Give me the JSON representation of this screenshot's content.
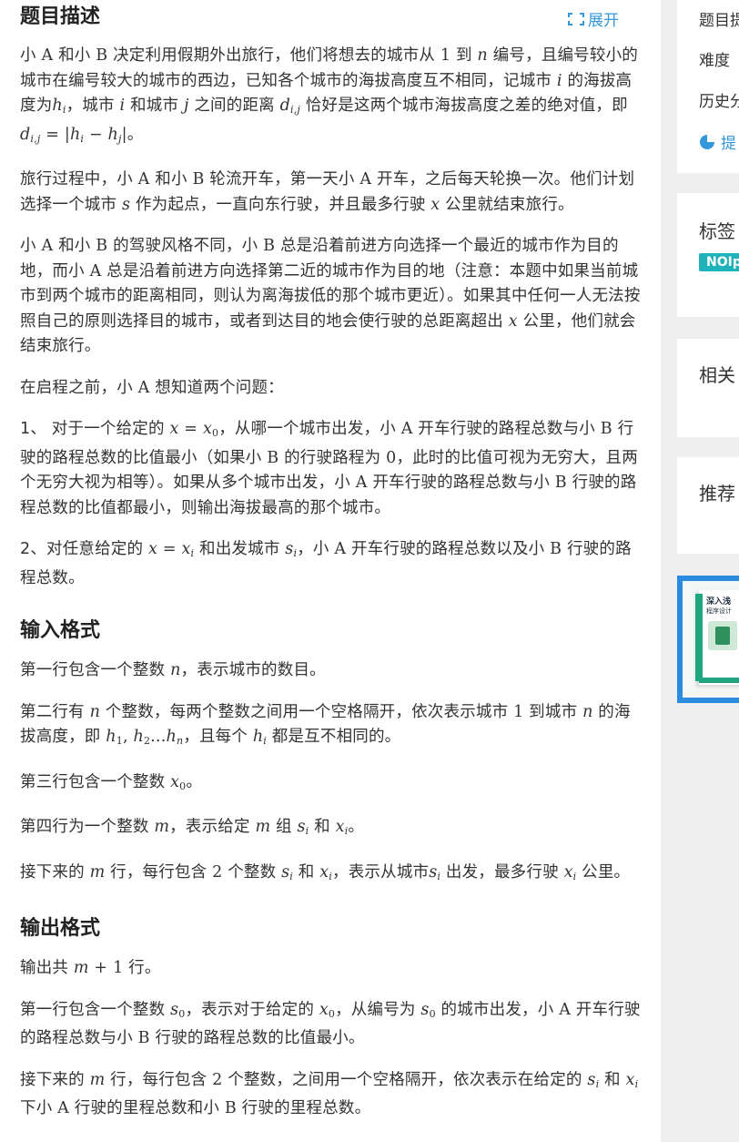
{
  "problem": {
    "title": "题目描述",
    "expand_label": "展开",
    "desc": {
      "p1": [
        "小 ",
        "A",
        " 和小 ",
        "B",
        " 决定利用假期外出旅行，他们将想去的城市从 ",
        "1",
        " 到 ",
        "n",
        " 编号，且编号较小的城市在编号较大的城市的西边，已知各个城市的海拔高度互不相同，记城市 ",
        "i",
        " 的海拔高度为",
        "h",
        "i",
        "，城市 ",
        "i",
        " 和城市 ",
        "j",
        " 之间的距离 ",
        "d",
        "i,j",
        " 恰好是这两个城市海拔高度之差的绝对值，即 ",
        "d",
        "i,j",
        " = |",
        "h",
        "i",
        " − ",
        "h",
        "j",
        "|",
        "。"
      ],
      "p2": [
        "旅行过程中，小 ",
        "A",
        " 和小 ",
        "B",
        " 轮流开车，第一天小 ",
        "A",
        " 开车，之后每天轮换一次。他们计划选择一个城市 ",
        "s",
        " 作为起点，一直向东行驶，并且最多行驶 ",
        "x",
        " 公里就结束旅行。"
      ],
      "p3": [
        "小 ",
        "A",
        " 和小 ",
        "B",
        " 的驾驶风格不同，小 ",
        "B",
        " 总是沿着前进方向选择一个最近的城市作为目的地，而小 ",
        "A",
        " 总是沿着前进方向选择第二近的城市作为目的地（注意：本题中如果当前城市到两个城市的距离相同，则认为离海拔低的那个城市更近）。如果其中任何一人无法按照自己的原则选择目的城市，或者到达目的地会使行驶的总距离超出 ",
        "x",
        " 公里，他们就会结束旅行。"
      ],
      "p4": [
        "在启程之前，小 ",
        "A",
        " 想知道两个问题："
      ],
      "p5": [
        "1、 对于一个给定的 ",
        "x",
        " = ",
        "x",
        "0",
        "，从哪一个城市出发，小 ",
        "A",
        " 开车行驶的路程总数与小 ",
        "B",
        " 行驶的路程总数的比值最小（如果小 ",
        "B",
        " 的行驶路程为 ",
        "0",
        "，此时的比值可视为无穷大，且两个无穷大视为相等）。如果从多个城市出发，小 ",
        "A",
        " 开车行驶的路程总数与小 ",
        "B",
        " 行驶的路程总数的比值都最小，则输出海拔最高的那个城市。"
      ],
      "p6": [
        "2、对任意给定的 ",
        "x",
        " = ",
        "x",
        "i",
        " 和出发城市 ",
        "s",
        "i",
        "，小 ",
        "A",
        " 开车行驶的路程总数以及小 ",
        "B",
        " 行驶的路程总数。"
      ]
    },
    "input_title": "输入格式",
    "input": {
      "i1": [
        "第一行包含一个整数 ",
        "n",
        "，表示城市的数目。"
      ],
      "i2": [
        "第二行有 ",
        "n",
        " 个整数，每两个整数之间用一个空格隔开，依次表示城市 ",
        "1",
        " 到城市 ",
        "n",
        " 的海拔高度，即 ",
        "h",
        "1",
        ", ",
        "h",
        "2",
        "...",
        "h",
        "n",
        "，且每个 ",
        "h",
        "i",
        " 都是互不相同的。"
      ],
      "i3": [
        "第三行包含一个整数 ",
        "x",
        "0",
        "。"
      ],
      "i4": [
        "第四行为一个整数 ",
        "m",
        "，表示给定 ",
        "m",
        " 组 ",
        "s",
        "i",
        " 和 ",
        "x",
        "i",
        "。"
      ],
      "i5": [
        "接下来的 ",
        "m",
        " 行，每行包含 ",
        "2",
        " 个整数 ",
        "s",
        "i",
        " 和 ",
        "x",
        "i",
        "，表示从城市",
        "s",
        "i",
        " 出发，最多行驶 ",
        "x",
        "i",
        " 公里。"
      ]
    },
    "output_title": "输出格式",
    "output": {
      "o1": [
        "输出共 ",
        "m",
        " + ",
        "1",
        " 行。"
      ],
      "o2": [
        "第一行包含一个整数 ",
        "s",
        "0",
        "，表示对于给定的 ",
        "x",
        "0",
        "，从编号为 ",
        "s",
        "0",
        " 的城市出发，小 ",
        "A",
        " 开车行驶的路程总数与小 ",
        "B",
        " 行驶的路程总数的比值最小。"
      ],
      "o3": [
        "接下来的 ",
        "m",
        " 行，每行包含 ",
        "2",
        " 个整数，之间用一个空格隔开，依次表示在给定的 ",
        "s",
        "i",
        " 和 ",
        "x",
        "i",
        " 下小 ",
        "A",
        " 行驶的里程总数和小 ",
        "B",
        " 行驶的里程总数。"
      ]
    }
  },
  "sidebar": {
    "info_label_1": "题目提",
    "info_label_2": "难度",
    "info_label_3": "历史分",
    "submit_stat_label": "提",
    "tags_title": "标签",
    "tag_1": "NOIp",
    "related_title": "相关",
    "recommend_title": "推荐",
    "book_text_1": "深入浅",
    "book_text_2": "程序设计"
  },
  "colors": {
    "accent": "#3498db",
    "tag": "#1fb2b8",
    "ad_border": "#2a8be0"
  }
}
